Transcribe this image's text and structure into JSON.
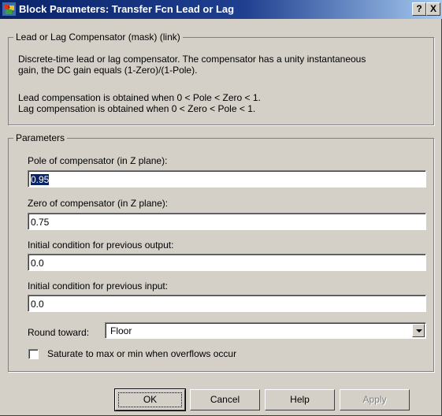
{
  "window": {
    "title": "Block Parameters: Transfer Fcn Lead or Lag",
    "help_label": "?",
    "close_label": "X",
    "icon": "simulink-block-icon"
  },
  "description": {
    "legend": "Lead or Lag Compensator (mask) (link)",
    "lines": [
      "Discrete-time lead or lag compensator.  The compensator has a unity instantaneous",
      "gain, the DC gain equals (1-Zero)/(1-Pole).",
      "Lead compensation is obtained when 0 < Pole < Zero < 1.",
      "Lag compensation is obtained when 0 < Zero < Pole < 1."
    ]
  },
  "parameters": {
    "legend": "Parameters",
    "fields": [
      {
        "label": "Pole of compensator (in Z plane):",
        "value": "0.95",
        "selected": true
      },
      {
        "label": "Zero of compensator (in Z plane):",
        "value": "0.75",
        "selected": false
      },
      {
        "label": "Initial condition for previous output:",
        "value": "0.0",
        "selected": false
      },
      {
        "label": "Initial condition for previous input:",
        "value": "0.0",
        "selected": false
      }
    ],
    "round_toward": {
      "label": "Round toward:",
      "value": "Floor"
    },
    "saturate": {
      "label": "Saturate to max or min when overflows occur",
      "checked": false
    }
  },
  "buttons": {
    "ok": "OK",
    "cancel": "Cancel",
    "help": "Help",
    "apply": "Apply"
  }
}
